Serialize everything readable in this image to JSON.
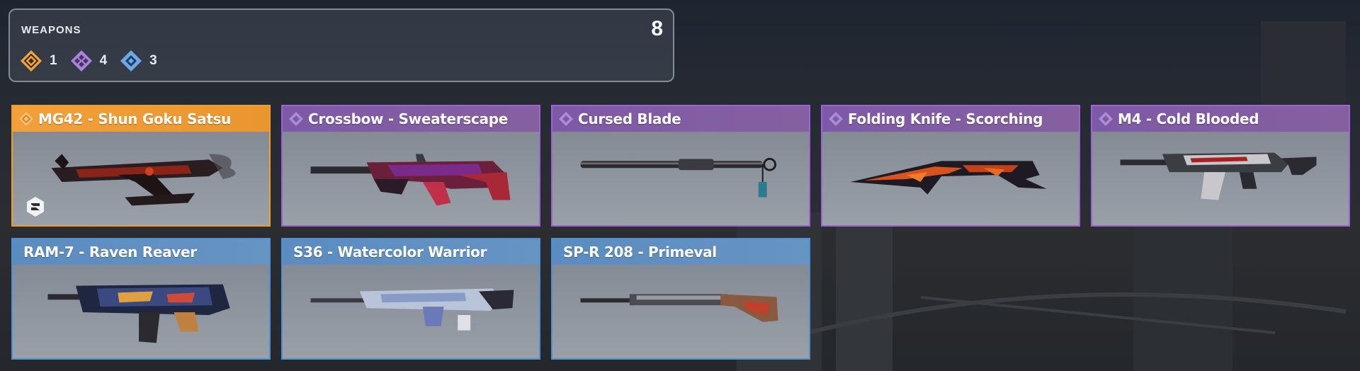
{
  "summary": {
    "title": "WEAPONS",
    "total": "8",
    "rarities": [
      {
        "icon": "legendary-rarity-icon",
        "color": "#f3a53c",
        "count": "1"
      },
      {
        "icon": "epic-rarity-icon",
        "color": "#a884dd",
        "count": "4"
      },
      {
        "icon": "rare-rarity-icon",
        "color": "#6fa8e6",
        "count": "3"
      }
    ]
  },
  "weapons": [
    {
      "name": "MG42 - Shun Goku Satsu",
      "rarity": "legendary",
      "mastery_icon": "mastery-badge-icon"
    },
    {
      "name": "Crossbow - Sweaterscape",
      "rarity": "epic"
    },
    {
      "name": "Cursed Blade",
      "rarity": "epic"
    },
    {
      "name": "Folding Knife - Scorching",
      "rarity": "epic"
    },
    {
      "name": "M4 - Cold Blooded",
      "rarity": "epic"
    },
    {
      "name": "RAM-7 - Raven Reaver",
      "rarity": "rare"
    },
    {
      "name": "S36 - Watercolor Warrior",
      "rarity": "rare"
    },
    {
      "name": "SP-R 208 - Primeval",
      "rarity": "rare"
    }
  ],
  "colors": {
    "legendary": "#f3a03a",
    "epic": "#9c62d8",
    "rare": "#4f8fd4"
  }
}
